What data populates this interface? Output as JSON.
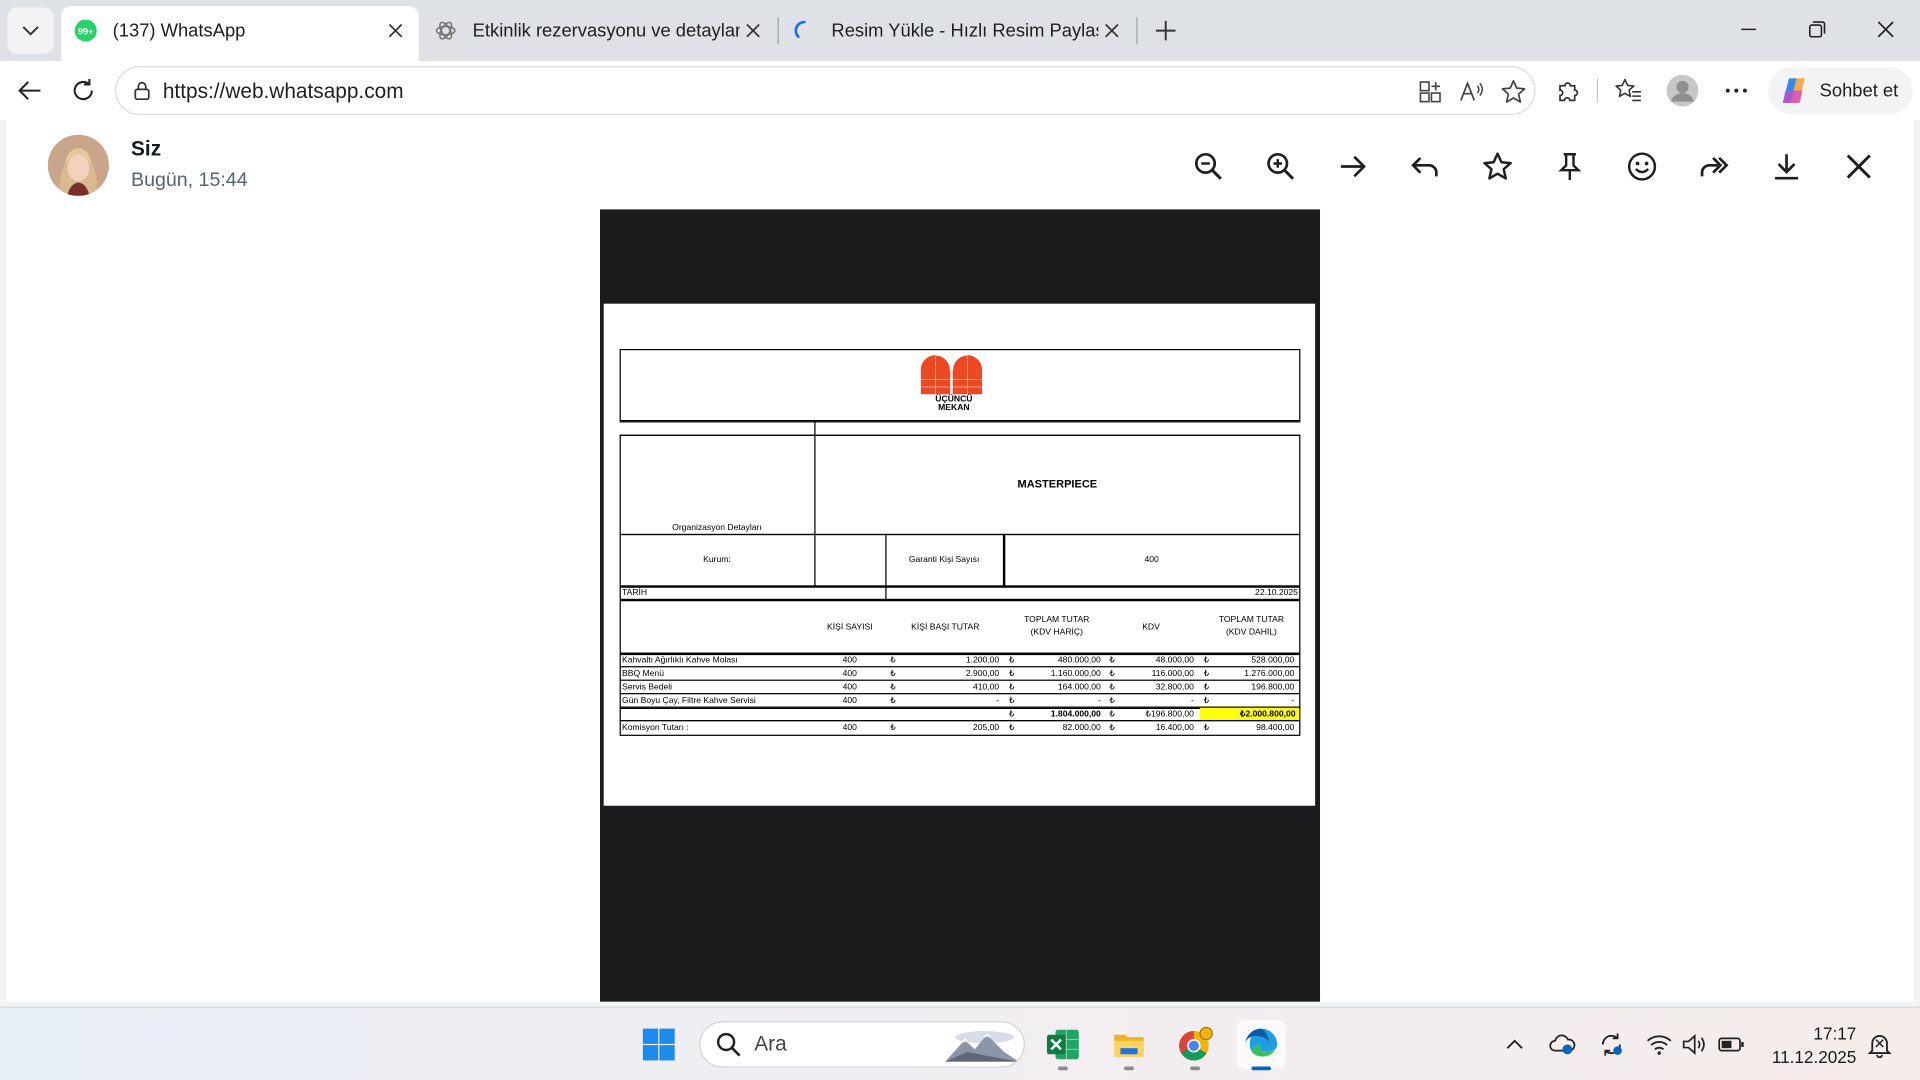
{
  "browser": {
    "tabs": [
      {
        "title": "(137) WhatsApp",
        "badge": "99+",
        "active": true
      },
      {
        "title": "Etkinlik rezervasyonu ve detaylar",
        "active": false
      },
      {
        "title": "Resim Yükle - Hızlı Resim Paylaş - İ",
        "active": false
      }
    ],
    "url": "https://web.whatsapp.com",
    "copilot_label": "Sohbet et"
  },
  "viewer": {
    "sender": "Siz",
    "time": "Bugün, 15:44"
  },
  "document": {
    "logo_line1": "ÜÇÜNCÜ",
    "logo_line2": "MEKAN",
    "title": "MASTERPIECE",
    "org_details_label": "Organizasyon Detayları",
    "institution_label": "Kurum:",
    "guarantee_label": "Garanti Kişi Sayısı",
    "guarantee_value": "400",
    "date_label": "TARİH",
    "date_value": "22.10.2025",
    "columns": {
      "people": "KİŞİ SAYISI",
      "per_person": "KİŞİ BAŞI TUTAR",
      "total_excl_1": "TOPLAM TUTAR",
      "total_excl_2": "(KDV HARİÇ)",
      "vat": "KDV",
      "total_incl_1": "TOPLAM TUTAR",
      "total_incl_2": "(KDV DAHİL)"
    },
    "currency": "₺",
    "rows": [
      {
        "name": "Kahvaltı Ağırlıklı Kahve Molası",
        "people": "400",
        "per": "1.200,00",
        "excl": "480.000,00",
        "vat": "48.000,00",
        "incl": "528.000,00"
      },
      {
        "name": "BBQ Menü",
        "people": "400",
        "per": "2.900,00",
        "excl": "1.160.000,00",
        "vat": "116.000,00",
        "incl": "1.276.000,00"
      },
      {
        "name": "Servis Bedeli",
        "people": "400",
        "per": "410,00",
        "excl": "164.000,00",
        "vat": "32.800,00",
        "incl": "196.800,00"
      },
      {
        "name": "Gün Boyu Çay, Filtre Kahve Servisi",
        "people": "400",
        "per": "-",
        "excl": "-",
        "vat": "-",
        "incl": "-"
      }
    ],
    "totals": {
      "excl": "1.804.000,00",
      "vat": "₺196.800,00",
      "incl": "₺2.000.800,00"
    },
    "commission": {
      "label": "Komisyon Tutarı :",
      "people": "400",
      "per": "205,00",
      "excl": "82.000,00",
      "vat": "16.400,00",
      "incl": "98.400,00"
    },
    "highlight_color": "#ffff00",
    "logo_color": "#ee4822"
  },
  "taskbar": {
    "search_label": "Ara",
    "time": "17:17",
    "date": "11.12.2025"
  },
  "colors": {
    "whatsapp_green": "#25d366",
    "edge_blue": "#0067c0",
    "excel_green": "#107c41"
  }
}
